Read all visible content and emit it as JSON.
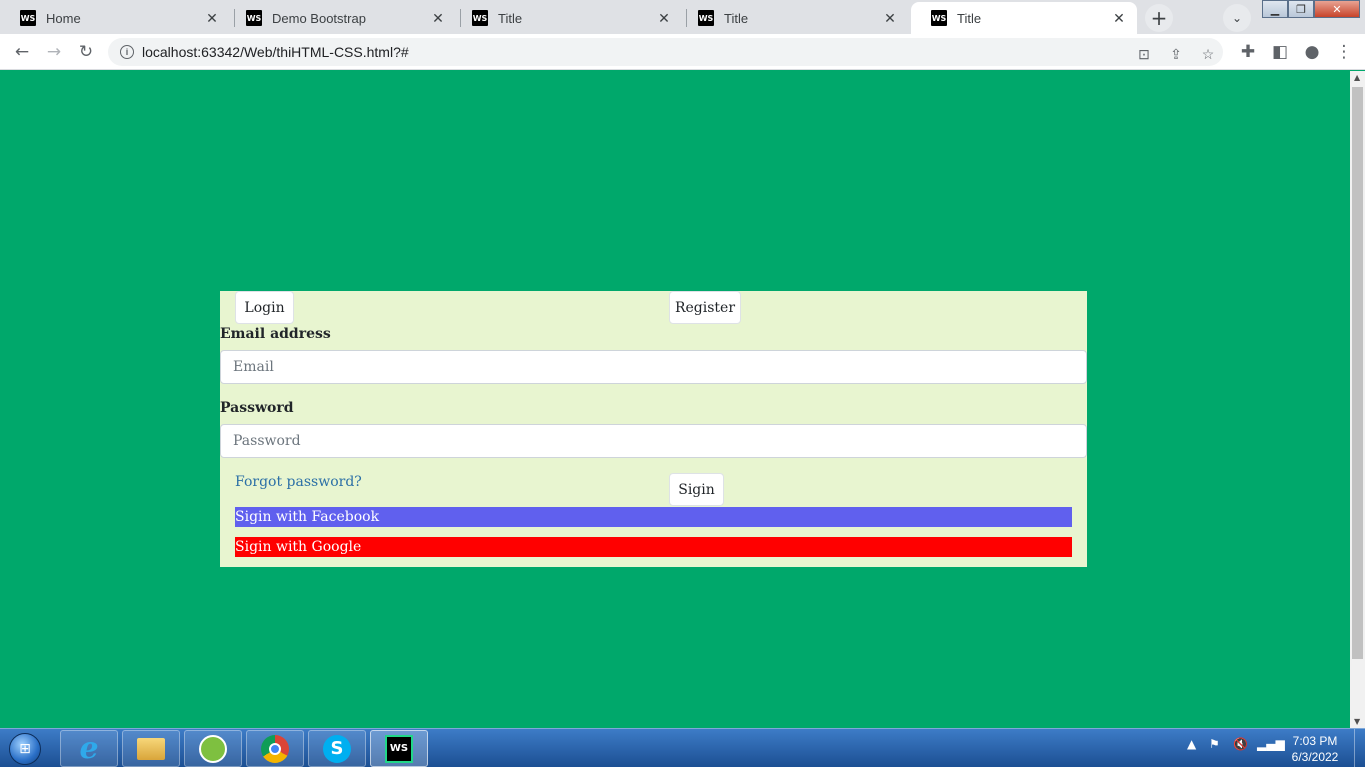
{
  "browser": {
    "tabs": [
      {
        "title": "Home",
        "icon": "webstorm-icon",
        "active": false
      },
      {
        "title": "Demo Bootstrap",
        "icon": "webstorm-icon",
        "active": false
      },
      {
        "title": "Title",
        "icon": "webstorm-icon",
        "active": false
      },
      {
        "title": "Title",
        "icon": "webstorm-icon",
        "active": false
      },
      {
        "title": "Title",
        "icon": "webstorm-icon",
        "active": true
      }
    ],
    "url": "localhost:63342/Web/thiHTML-CSS.html?#"
  },
  "page": {
    "background": "#00a86b",
    "login_tab": "Login",
    "register_tab": "Register",
    "email_label": "Email address",
    "email_placeholder": "Email",
    "password_label": "Password",
    "password_placeholder": "Password",
    "forgot_link": "Forgot password?",
    "signin_button": "Sigin",
    "facebook_button": "Sigin with Facebook",
    "google_button": "Sigin with Google",
    "facebook_color": "#6060ee",
    "google_color": "#ff0000"
  },
  "taskbar": {
    "apps": [
      "start-orb",
      "internet-explorer",
      "file-explorer",
      "green-app",
      "chrome",
      "skype",
      "webstorm"
    ],
    "time": "7:03 PM",
    "date": "6/3/2022"
  }
}
